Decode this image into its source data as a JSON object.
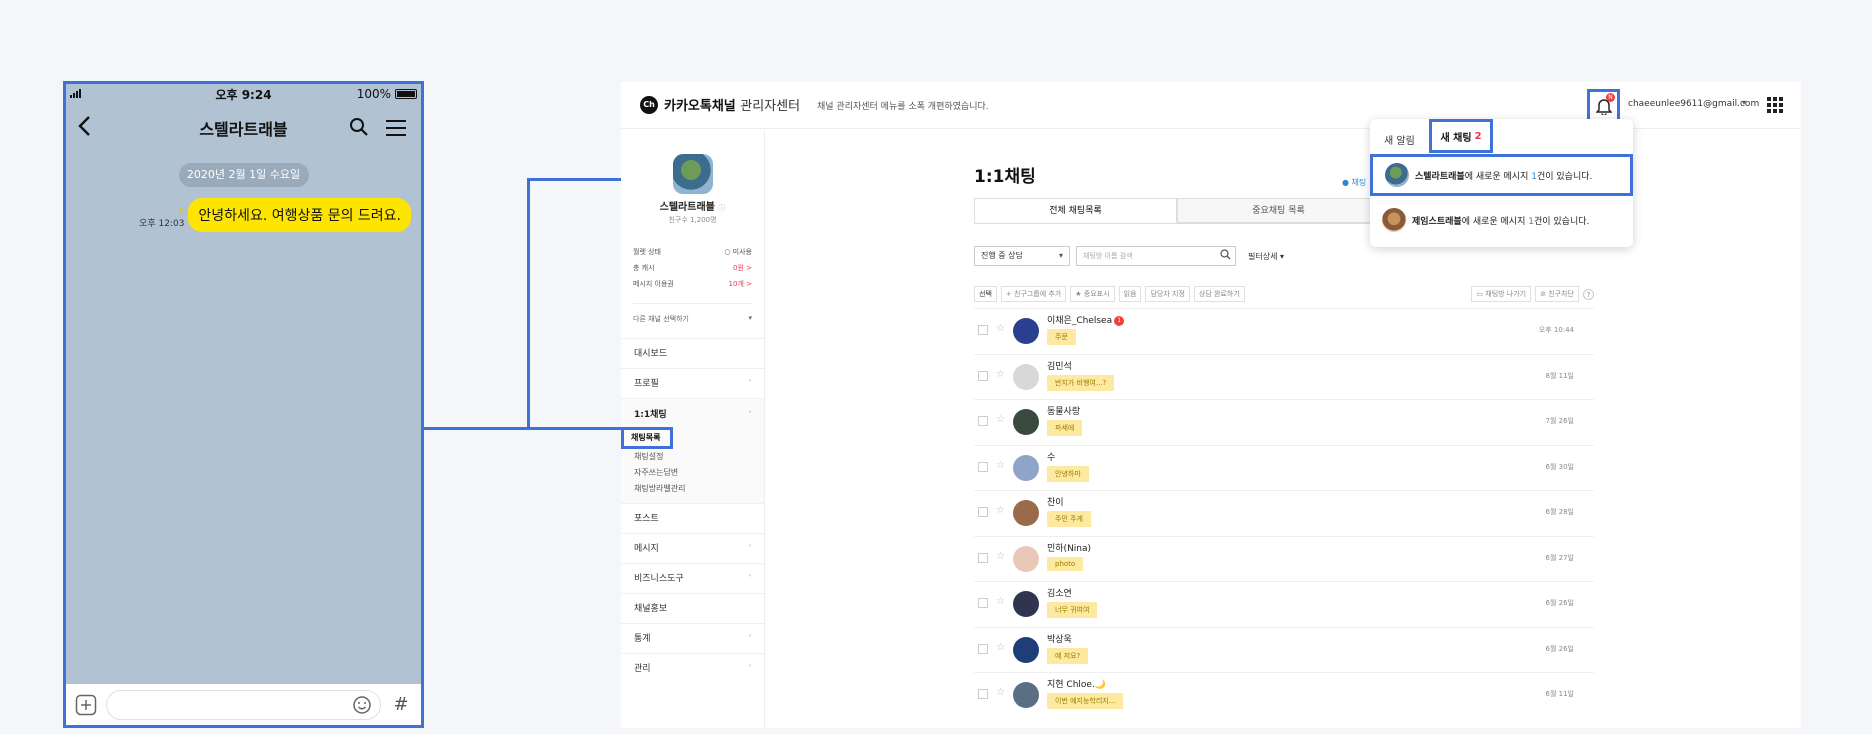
{
  "phone": {
    "status_time": "오후 9:24",
    "battery": "100%",
    "title": "스텔라트래블",
    "date_chip": "2020년 2월 1일 수요일",
    "message": {
      "text": "안녕하세요. 여행상품 문의 드려요.",
      "unread": "1",
      "time": "오후 12:03"
    },
    "input_hash": "#"
  },
  "admin": {
    "logo_text": "카카오톡채널",
    "logo_sub": "관리자센터",
    "logo_icon": "Ch",
    "notice": "채널 관리자센터 메뉴를 소폭 개편하였습니다.",
    "bell_badge": "N",
    "email": "chaeeunlee9611@gmail.com",
    "sidebar": {
      "channel_name": "스텔라트래블",
      "friends": "친구수 1,200명",
      "stats": [
        {
          "label": "월렛 상태",
          "value": "○ 미사용"
        },
        {
          "label": "충 캐시",
          "value": "0원 >"
        },
        {
          "label": "메시지 이용권",
          "value": "10개 >"
        }
      ],
      "other_channel": "다른 채널 선택하기",
      "menu_top": [
        {
          "label": "대시보드",
          "chev": ""
        },
        {
          "label": "프로필",
          "chev": "˅"
        }
      ],
      "active_group": {
        "head": "1:1채팅",
        "chev": "˄",
        "current": "채팅목록",
        "subs": [
          "채팅설정",
          "자주쓰는답변",
          "채팅방라벨관리"
        ]
      },
      "menu_bottom": [
        {
          "label": "포스트",
          "chev": ""
        },
        {
          "label": "메시지",
          "chev": "˅"
        },
        {
          "label": "비즈니스도구",
          "chev": "˅"
        },
        {
          "label": "채널홍보",
          "chev": ""
        },
        {
          "label": "통계",
          "chev": "˅"
        },
        {
          "label": "관리",
          "chev": "˅"
        }
      ]
    },
    "main": {
      "title": "1:1채팅",
      "status": "● 채팅",
      "tabs": [
        "전체 채팅목록",
        "중요채팅 목록"
      ],
      "status_dropdown": "진행 중 상담",
      "search_placeholder": "채팅방 이름 검색",
      "filter_detail": "필터상세 ▾",
      "actions": [
        "선택",
        "+ 친구그룹에 추가",
        "★ 중요표시",
        "읽음",
        "담당자 지정",
        "상담 완료하기"
      ],
      "actions_right": [
        "▭ 채팅방 나가기",
        "⊘ 친구차단",
        "?"
      ],
      "rows": [
        {
          "name": "이채은_Chelsea",
          "tag": "주문",
          "date": "오후 10:44",
          "new": "1",
          "avatar_color": "#2a3f8f"
        },
        {
          "name": "김민석",
          "tag": "반지가 비행여...?",
          "date": "8월 11일",
          "new": "",
          "avatar_color": "#d8d8d8"
        },
        {
          "name": "동물사랑",
          "tag": "파세에",
          "date": "7월 26일",
          "new": "",
          "avatar_color": "#3b4a3e"
        },
        {
          "name": "수",
          "tag": "안녕하마",
          "date": "6월 30일",
          "new": "",
          "avatar_color": "#8fa5c8"
        },
        {
          "name": "찬이",
          "tag": "주민 주게",
          "date": "6월 28일",
          "new": "",
          "avatar_color": "#9a6b4a"
        },
        {
          "name": "민하(Nina)",
          "tag": "photo",
          "date": "6월 27일",
          "new": "",
          "avatar_color": "#e9c8b8"
        },
        {
          "name": "김소연",
          "tag": "너무 귀여여",
          "date": "6월 26일",
          "new": "",
          "avatar_color": "#2f3550"
        },
        {
          "name": "박상욱",
          "tag": "예 저요?",
          "date": "6월 26일",
          "new": "",
          "avatar_color": "#1f3e78"
        },
        {
          "name": "지현 Chloe.🌙",
          "tag": "이번 예지능학리지...",
          "date": "6월 11일",
          "new": "",
          "avatar_color": "#5a6f84"
        }
      ]
    },
    "popup": {
      "tab1": "새 알림",
      "tab2": "새 채팅",
      "tab2_count": "2",
      "items": [
        {
          "channel": "스텔라트래블",
          "mid": "에 새로운 메시지 ",
          "num": "1",
          "tail": "건이 있습니다."
        },
        {
          "channel": "제임스트래블",
          "mid": "에 새로운 메시지 ",
          "num": "1",
          "tail": "건이 있습니다."
        }
      ]
    }
  }
}
